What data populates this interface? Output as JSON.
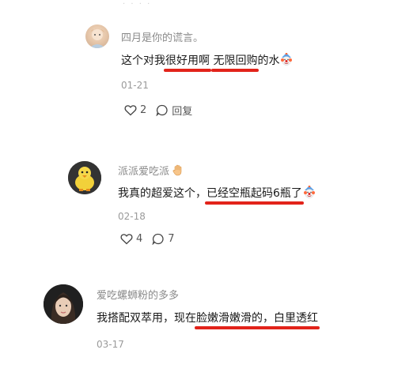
{
  "comments": [
    {
      "username": "四月是你的谎言。",
      "text_before": "这个对我",
      "hl1": "很好用啊",
      "text_mid": " ",
      "hl2": "无限回购",
      "text_after": "的水",
      "date": "01-21",
      "like_count": "2",
      "reply_label": "回复"
    },
    {
      "username": "派派爱吃派",
      "text_before": "我真的超爱这个，",
      "hl1": "已经空瓶起码6瓶了",
      "date": "02-18",
      "like_count": "4",
      "reply_count": "7"
    },
    {
      "username": "爱吃螺蛳粉的多多",
      "text_before": "我搭配双萃用，现在",
      "hl1": "脸嫩滑嫩滑的，白里透红",
      "date": "03-17"
    }
  ],
  "colors": {
    "underline": "#e2231a",
    "username": "#8a8a8a",
    "date": "#9a9a9a"
  },
  "icons": [
    "heart-icon",
    "comment-bubble-icon",
    "clown-emoji-icon",
    "hand-emoji-icon"
  ]
}
